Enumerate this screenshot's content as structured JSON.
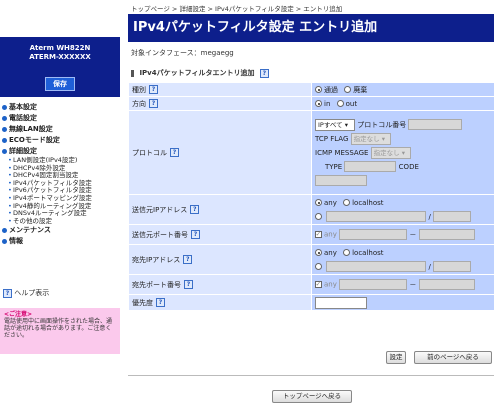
{
  "sidebar": {
    "model": "Aterm WH822N",
    "name": "ATERM-XXXXXX",
    "save_label": "保存",
    "menu": [
      {
        "label": "基本設定",
        "type": "top"
      },
      {
        "label": "電話設定",
        "type": "top"
      },
      {
        "label": "無線LAN設定",
        "type": "top"
      },
      {
        "label": "ECOモード設定",
        "type": "top"
      },
      {
        "label": "詳細設定",
        "type": "top"
      },
      {
        "label": "LAN側設定(IPv4設定)",
        "type": "sub"
      },
      {
        "label": "DHCPv4除外設定",
        "type": "sub"
      },
      {
        "label": "DHCPv4固定割当設定",
        "type": "sub"
      },
      {
        "label": "IPv4パケットフィルタ設定",
        "type": "sub"
      },
      {
        "label": "IPv6パケットフィルタ設定",
        "type": "sub"
      },
      {
        "label": "IPv4ポートマッピング設定",
        "type": "sub"
      },
      {
        "label": "IPv4静的ルーティング設定",
        "type": "sub"
      },
      {
        "label": "DNSv4ルーティング設定",
        "type": "sub"
      },
      {
        "label": "その他の設定",
        "type": "sub"
      },
      {
        "label": "メンテナンス",
        "type": "top"
      },
      {
        "label": "情報",
        "type": "top"
      }
    ],
    "help_label": "ヘルプ表示",
    "notice_title": "<ご注意>",
    "notice_text": "電話使用中に画面操作をされた場合、通話が途切れる場合があります。ご注意ください。"
  },
  "main": {
    "breadcrumb": "トップページ > 詳細設定 > IPv4パケットフィルタ設定 > エントリ追加",
    "title": "IPv4パケットフィルタ設定 エントリ追加",
    "interface": "対象インタフェース：megaegg",
    "section_title": "IPv4パケットフィルタエントリ追加",
    "help_icon": "?",
    "rows": {
      "type": {
        "label": "種別",
        "opt1": "通過",
        "opt2": "廃棄"
      },
      "direction": {
        "label": "方向",
        "opt1": "in",
        "opt2": "out"
      },
      "protocol": {
        "label": "プロトコル",
        "select": "IPすべて",
        "proto_num_label": "プロトコル番号",
        "tcp_flag_label": "TCP FLAG",
        "tcp_flag_value": "指定なし",
        "icmp_label": "ICMP MESSAGE",
        "icmp_value": "指定なし",
        "type_label": "TYPE",
        "code_label": "CODE"
      },
      "src_ip": {
        "label": "送信元IPアドレス",
        "opt1": "any",
        "opt2": "localhost",
        "slash": "/"
      },
      "src_port": {
        "label": "送信元ポート番号",
        "any": "any",
        "dash": "－"
      },
      "dst_ip": {
        "label": "宛先IPアドレス",
        "opt1": "any",
        "opt2": "localhost",
        "slash": "/"
      },
      "dst_port": {
        "label": "宛先ポート番号",
        "any": "any",
        "dash": "－"
      },
      "priority": {
        "label": "優先度"
      }
    },
    "set_button": "設定",
    "back_button": "前のページへ戻る",
    "top_button": "トップページへ戻る"
  }
}
